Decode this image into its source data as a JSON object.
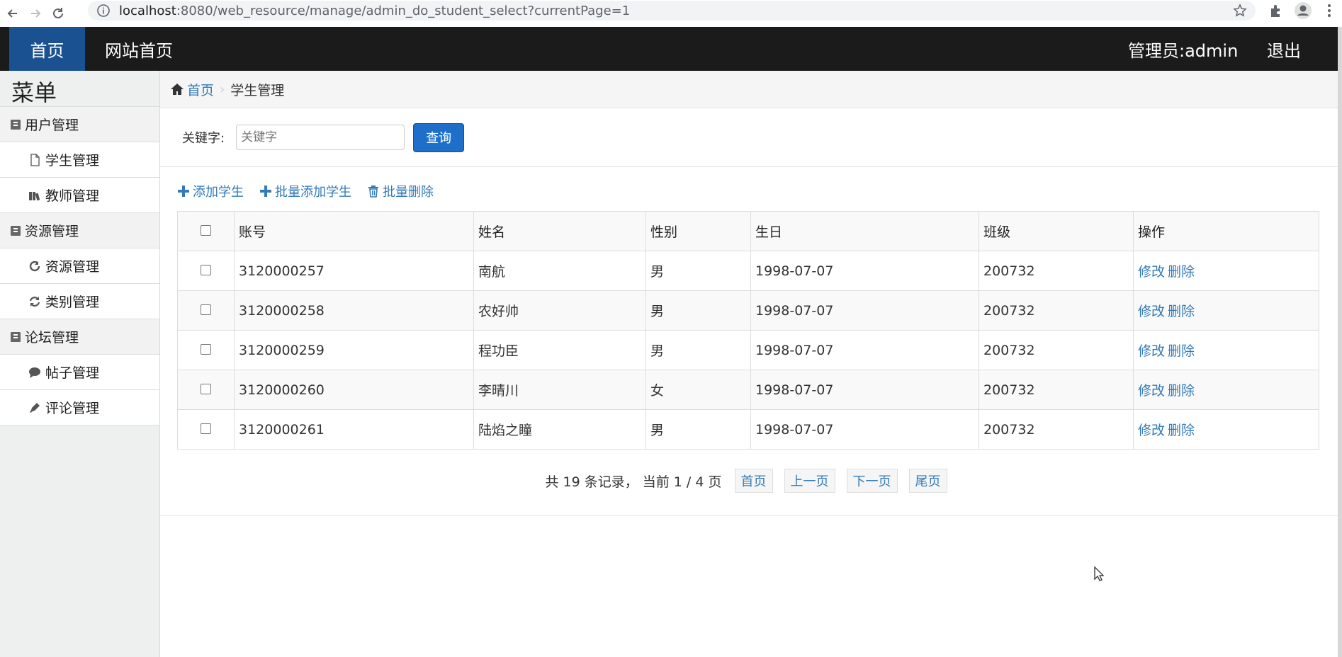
{
  "browser": {
    "url_host": "localhost",
    "url_path": ":8080/web_resource/manage/admin_do_student_select?currentPage=1"
  },
  "topbar": {
    "home": "首页",
    "site_home": "网站首页",
    "admin": "管理员:admin",
    "logout": "退出"
  },
  "sidebar": {
    "title": "菜单",
    "groups": [
      {
        "label": "用户管理",
        "items": [
          {
            "label": "学生管理",
            "icon": "file-icon"
          },
          {
            "label": "教师管理",
            "icon": "books-icon"
          }
        ]
      },
      {
        "label": "资源管理",
        "items": [
          {
            "label": "资源管理",
            "icon": "refresh-icon"
          },
          {
            "label": "类别管理",
            "icon": "sync-icon"
          }
        ]
      },
      {
        "label": "论坛管理",
        "items": [
          {
            "label": "帖子管理",
            "icon": "comment-icon"
          },
          {
            "label": "评论管理",
            "icon": "pen-icon"
          }
        ]
      }
    ]
  },
  "breadcrumb": {
    "home": "首页",
    "current": "学生管理"
  },
  "search": {
    "label": "关键字:",
    "placeholder": "关键字",
    "button": "查询"
  },
  "actions": {
    "add": "添加学生",
    "batch_add": "批量添加学生",
    "batch_delete": "批量删除"
  },
  "table": {
    "headers": [
      "账号",
      "姓名",
      "性别",
      "生日",
      "班级",
      "操作"
    ],
    "rows": [
      {
        "account": "3120000257",
        "name": "南航",
        "gender": "男",
        "birthday": "1998-07-07",
        "class": "200732"
      },
      {
        "account": "3120000258",
        "name": "农好帅",
        "gender": "男",
        "birthday": "1998-07-07",
        "class": "200732"
      },
      {
        "account": "3120000259",
        "name": "程功臣",
        "gender": "男",
        "birthday": "1998-07-07",
        "class": "200732"
      },
      {
        "account": "3120000260",
        "name": "李晴川",
        "gender": "女",
        "birthday": "1998-07-07",
        "class": "200732"
      },
      {
        "account": "3120000261",
        "name": "陆焰之瞳",
        "gender": "男",
        "birthday": "1998-07-07",
        "class": "200732"
      }
    ],
    "edit": "修改",
    "delete": "删除"
  },
  "pager": {
    "info": "共 19 条记录， 当前 1 / 4 页",
    "first": "首页",
    "prev": "上一页",
    "next": "下一页",
    "last": "尾页"
  },
  "colors": {
    "topbar": "#1b1b1b",
    "active_tab": "#1a5190",
    "link": "#337ab7",
    "primary_button": "#1e6fc9"
  }
}
